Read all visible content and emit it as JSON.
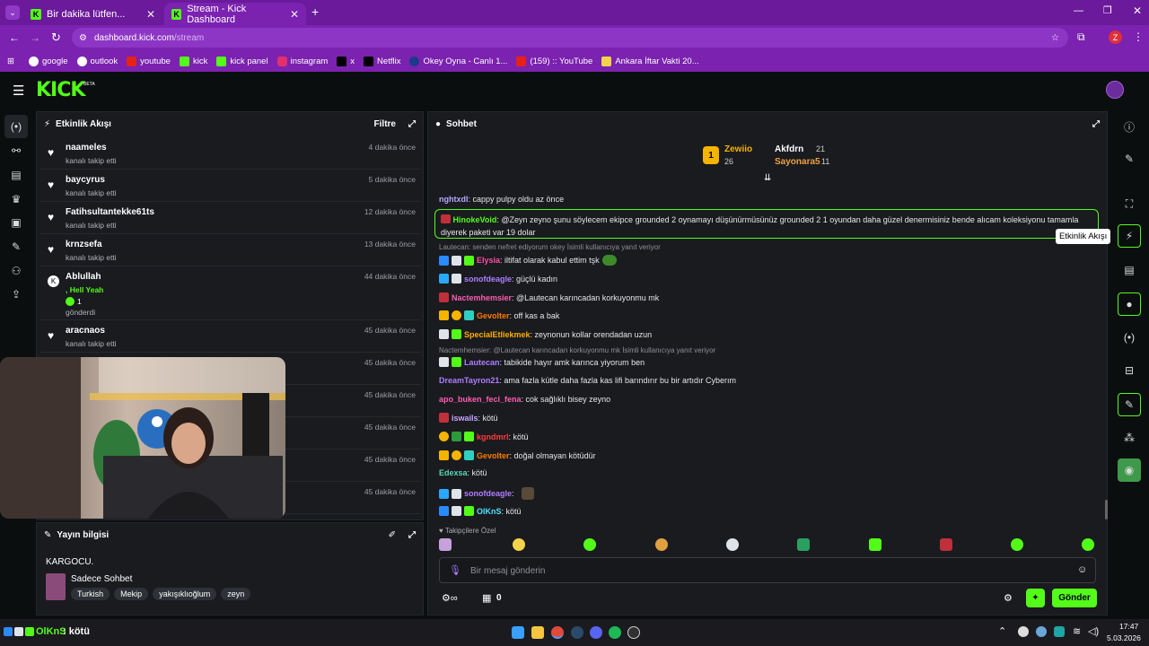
{
  "browser": {
    "tabs": [
      {
        "title": "Bir dakika lütfen...",
        "active": false
      },
      {
        "title": "Stream - Kick Dashboard",
        "active": true
      }
    ],
    "new_tab": "+",
    "url_host": "dashboard.kick.com",
    "url_path": "/stream",
    "profile_initial": "Z",
    "bookmarks": [
      "google",
      "outlook",
      "youtube",
      "kick",
      "kick panel",
      "instagram",
      "x",
      "Netflix",
      "Okey Oyna - Canlı 1...",
      "(159) :: YouTube",
      "Ankara İftar Vakti 20..."
    ]
  },
  "kick": {
    "logo": "KICK",
    "logo_badge": "BETA"
  },
  "activity": {
    "title": "Etkinlik Akışı",
    "filter": "Filtre",
    "items": [
      {
        "user": "naameles",
        "action": "kanalı takip etti",
        "time": "4 dakika önce"
      },
      {
        "user": "baycyrus",
        "action": "kanalı takip etti",
        "time": "5 dakika önce"
      },
      {
        "user": "Fatihsultantekke61ts",
        "action": "kanalı takip etti",
        "time": "12 dakika önce"
      },
      {
        "user": "krnzsefa",
        "action": "kanalı takip etti",
        "time": "13 dakika önce"
      },
      {
        "user": "Ablullah",
        "extra": ", Hell Yeah",
        "count": "1",
        "action": "gönderdi",
        "time": "44 dakika önce"
      },
      {
        "user": "aracnaos",
        "action": "kanalı takip etti",
        "time": "45 dakika önce"
      }
    ],
    "hidden_times": [
      "45 dakika önce",
      "45 dakika önce",
      "45 dakika önce",
      "45 dakika önce",
      "45 dakika önce"
    ]
  },
  "stream_info": {
    "title": "Yayın bilgisi",
    "stream_title": "KARGOCU.",
    "category": "Sadece Sohbet",
    "tags": [
      "Turkish",
      "Mekip",
      "yakışıklıoğlum",
      "zeyn"
    ]
  },
  "chat": {
    "title": "Sohbet",
    "leaderboard": {
      "first_name": "Zewiio",
      "first_count": "26",
      "first_rank": "1",
      "left": [
        {
          "name": "Akfdrn",
          "count": "21"
        },
        {
          "name": "Sayonara5",
          "count": "11"
        }
      ]
    },
    "messages": [
      {
        "user": "nghtxdl",
        "text": ": cappy pulpy oldu az önce",
        "color": "#b9a6ff"
      },
      {
        "user": "HinokeVoid",
        "text": ": @Zeyn zeyno şunu söylecem ekipce grounded 2 oynamayı düşünürmüsünüz grounded 2 1 oyundan daha güzel denermisiniz bende alıcam koleksiyonu tamamla diyerek paketi var 19 dolar",
        "color": "#53fc18",
        "highlight": true
      },
      {
        "reply": "Lautecan: senden nefret ediyorum okey  İsimli kullanıcıya yanıt veriyor"
      },
      {
        "user": "Elysia",
        "text": ": iltifat olarak kabul ettim tşk",
        "color": "#ff4da6"
      },
      {
        "user": "sonofdeagle",
        "text": ": güçlü kadın",
        "color": "#b07cff"
      },
      {
        "user": "Nactemhemsier",
        "text": ": @Lautecan karıncadan korkuyonmu mk",
        "color": "#ff5cb4"
      },
      {
        "user": "Gevolter",
        "text": ": off kas a bak",
        "color": "#ff7a00"
      },
      {
        "user": "SpecialEtliekmek",
        "text": ": zeynonun kollar orendadan uzun",
        "color": "#ffae00"
      },
      {
        "reply": "Nactemhemsier: @Lautecan karıncadan korkuyonmu mk  İsimli kullanıcıya yanıt veriyor"
      },
      {
        "user": "Lautecan",
        "text": ": tabikide hayır amk karınca yiyorum ben",
        "color": "#b07cff"
      },
      {
        "user": "DreamTayron21",
        "text": ": ama fazla kütle daha fazla kas lifi barındırır bu bir artıdır Cyberım",
        "color": "#b07cff"
      },
      {
        "user": "apo_buken_feci_fena",
        "text": ": cok sağlıklı bisey zeyno",
        "color": "#ff5cb4"
      },
      {
        "user": "iswails",
        "text": ": kötü",
        "color": "#c9a6ff"
      },
      {
        "user": "kgndmrl",
        "text": ": kötü",
        "color": "#ff3b3b"
      },
      {
        "user": "Gevolter",
        "text": ": doğal olmayan kötüdür",
        "color": "#ff7a00"
      },
      {
        "user": "Edexsa",
        "text": ": kötü",
        "color": "#5bd6b5"
      },
      {
        "user": "sonofdeagle",
        "text": ":",
        "color": "#b07cff"
      },
      {
        "user": "OlKnS",
        "text": ": kötü",
        "color": "#4fe3ff"
      }
    ],
    "emote_label": "Takipçilere Özel",
    "input_placeholder": "Bir mesaj gönderin",
    "footer_count": "0",
    "send_label": "Gönder",
    "tooltip": "Etkinlik Akışı"
  },
  "taskbar": {
    "ticker_user": "OlKnS",
    "ticker_text": " : kötü",
    "time": "17:47",
    "date": "5.03.2026"
  }
}
